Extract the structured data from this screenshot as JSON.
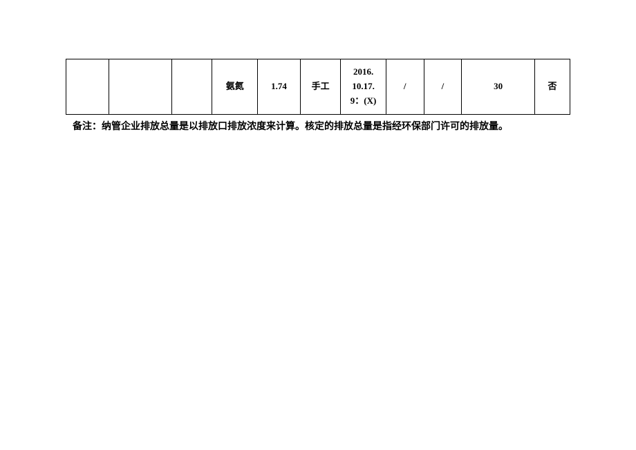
{
  "table": {
    "row": {
      "c1": "",
      "c2": "",
      "c3": "",
      "c4": "氨氮",
      "c5": "1.74",
      "c6": "手工",
      "c7": "2016.\n10.17.\n9：(X)",
      "c8": "/",
      "c9": "/",
      "c10": "30",
      "c11": "否"
    }
  },
  "note": "备注：纳管企业排放总量是以排放口排放浓度来计算。核定的排放总量是指经环保部门许可的排放量。"
}
